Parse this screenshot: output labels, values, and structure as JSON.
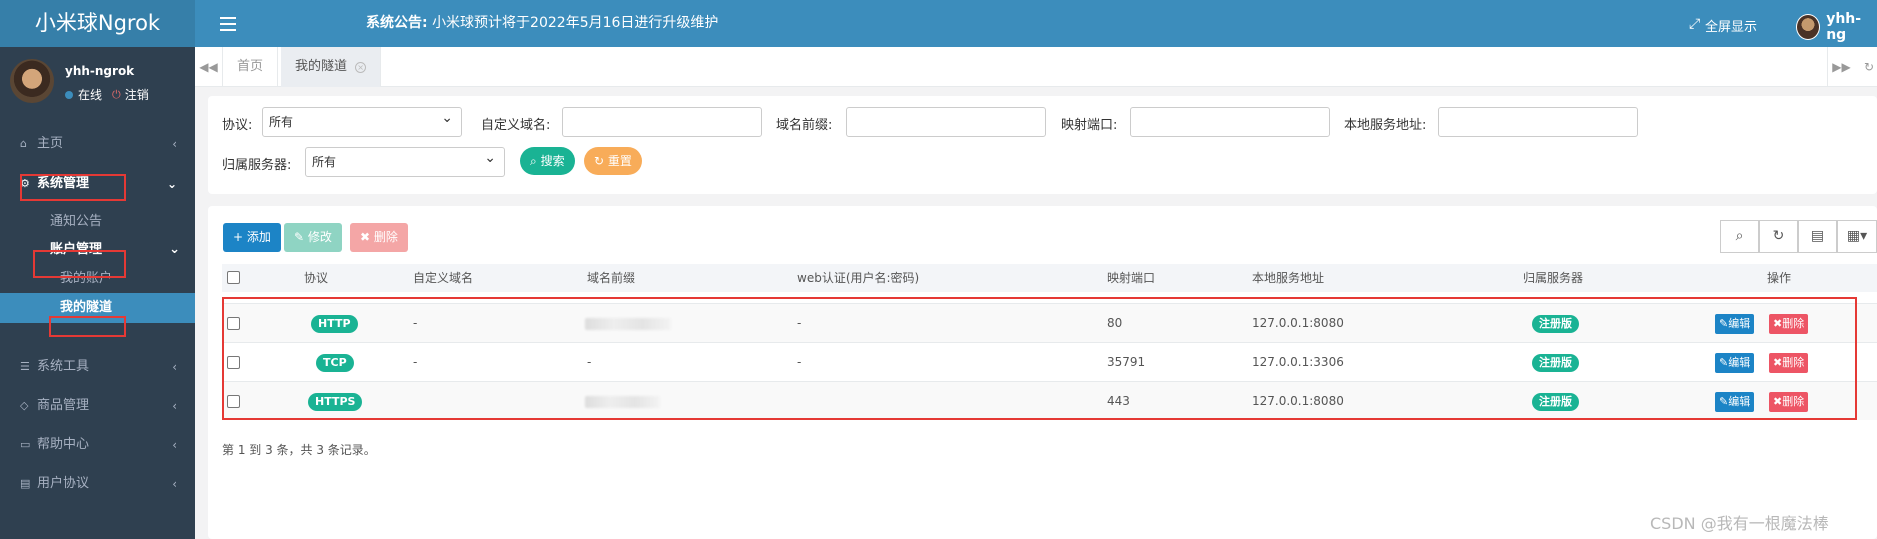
{
  "app": {
    "brand": "小米球Ngrok",
    "accent": "#3c8dbc"
  },
  "topbar": {
    "notice_label": "系统公告:",
    "notice_text": "小米球预计将于2022年5月16日进行升级维护",
    "fullscreen": "全屏显示",
    "username": "yhh-ng"
  },
  "sidebar": {
    "username": "yhh-ngrok",
    "online": "在线",
    "logout": "注销",
    "items": [
      {
        "label": "主页",
        "icon": "home-icon"
      },
      {
        "label": "系统管理",
        "icon": "gear-icon"
      },
      {
        "label": "通知公告"
      },
      {
        "label": "账户管理"
      },
      {
        "label": "我的账户"
      },
      {
        "label": "我的隧道"
      },
      {
        "label": "系统工具",
        "icon": "bars-icon"
      },
      {
        "label": "商品管理",
        "icon": "diamond-icon"
      },
      {
        "label": "帮助中心",
        "icon": "monitor-icon"
      },
      {
        "label": "用户协议",
        "icon": "card-icon"
      }
    ]
  },
  "tabs": [
    {
      "label": "首页"
    },
    {
      "label": "我的隧道"
    }
  ],
  "search": {
    "protocol_label": "协议:",
    "protocol_value": "所有",
    "custom_domain_label": "自定义域名:",
    "prefix_label": "域名前缀:",
    "port_label": "映射端口:",
    "local_addr_label": "本地服务地址:",
    "server_label": "归属服务器:",
    "server_value": "所有",
    "search_btn": "搜索",
    "reset_btn": "重置"
  },
  "toolbar": {
    "add": "添加",
    "edit": "修改",
    "delete": "删除"
  },
  "table": {
    "headers": [
      "协议",
      "自定义域名",
      "域名前缀",
      "web认证(用户名:密码)",
      "映射端口",
      "本地服务地址",
      "归属服务器",
      "操作"
    ],
    "rows": [
      {
        "protocol": "HTTP",
        "custom_domain": "-",
        "auth": "-",
        "port": "80",
        "local": "127.0.0.1:8080",
        "server": "注册版"
      },
      {
        "protocol": "TCP",
        "custom_domain": "-",
        "prefix": "-",
        "auth": "-",
        "port": "35791",
        "local": "127.0.0.1:3306",
        "server": "注册版"
      },
      {
        "protocol": "HTTPS",
        "port": "443",
        "local": "127.0.0.1:8080",
        "server": "注册版"
      }
    ],
    "edit_label": "编辑",
    "delete_label": "删除",
    "footer": "第 1 到 3 条，共 3 条记录。"
  },
  "watermark": "CSDN @我有一根魔法棒"
}
